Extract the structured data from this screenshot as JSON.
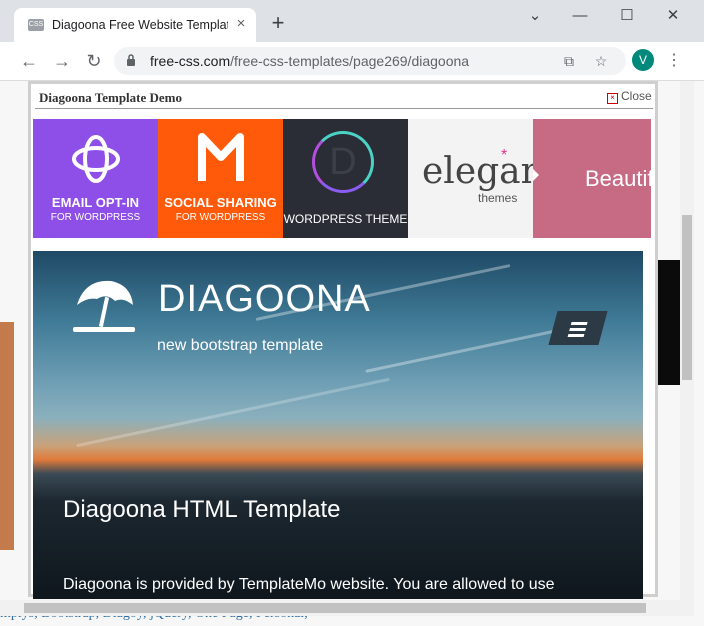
{
  "browser": {
    "tab_title": "Diagoona Free Website Template",
    "tab_favicon_text": "CSS",
    "new_tab": "+",
    "url_host": "free-css.com",
    "url_path": "/free-css-templates/page269/diagoona",
    "profile_initial": "V"
  },
  "modal": {
    "title": "Diagoona Template Demo",
    "close_label": "Close"
  },
  "ads": [
    {
      "line1": "EMAIL OPT-IN",
      "line2": "FOR WORDPRESS",
      "color": "#8d4fe8"
    },
    {
      "line1": "SOCIAL SHARING",
      "line2": "FOR WORDPRESS",
      "color": "#ff5a0a"
    },
    {
      "line1": "WORDPRESS THEME",
      "letter": "D",
      "color": "#2a2c36"
    },
    {
      "brand": "elegant",
      "sub": "themes",
      "color": "#f3f3f3"
    },
    {
      "text": "Beautif",
      "color": "#c76a83"
    }
  ],
  "hero": {
    "brand": "DIAGOONA",
    "tagline": "new bootstrap template",
    "heading": "Diagoona HTML Template",
    "paragraph": "Diagoona is provided by TemplateMo website. You are allowed to use"
  },
  "background_tags": "mplys, Bootstrap, Diagoy, jQuery, One Page, Personal,"
}
